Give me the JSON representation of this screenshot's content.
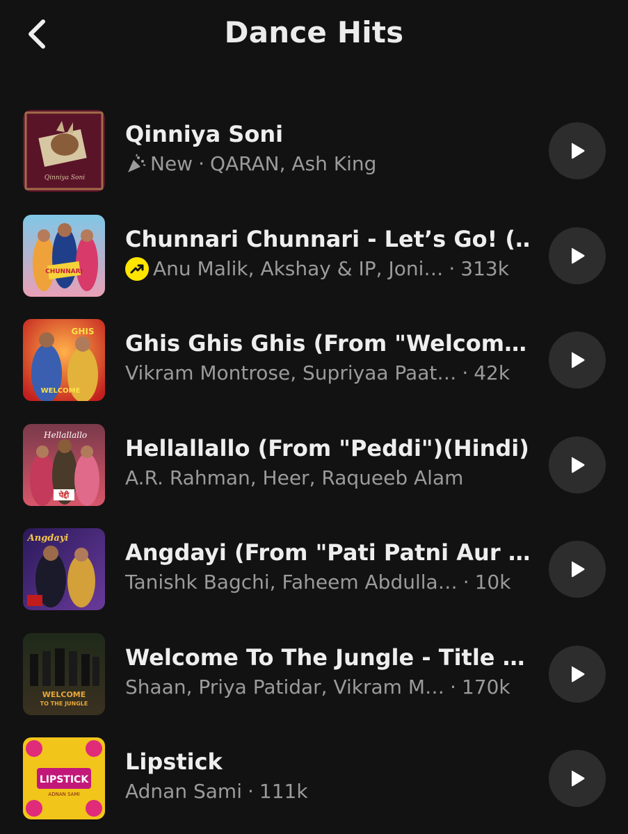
{
  "header": {
    "title": "Dance Hits",
    "back_icon": "chevron-left-icon"
  },
  "colors": {
    "background": "#121212",
    "play_button_bg": "#2d2d2d",
    "trending_badge": "#ffe500",
    "subtitle_text": "#9b9b9b"
  },
  "tracks": [
    {
      "title": "Qinniya Soni",
      "badge_icon": "party-popper-icon",
      "new_label": "New",
      "artists": "QARAN, Ash King",
      "plays": ""
    },
    {
      "title": "Chunnari Chunnari - Let’s Go! (…",
      "badge_icon": "trending-up-icon",
      "artists": "Anu Malik, Akshay & IP, Joni…",
      "plays": "313k"
    },
    {
      "title": "Ghis Ghis Ghis (From \"Welcom…",
      "artists": "Vikram Montrose, Supriyaa Paat…",
      "plays": "42k"
    },
    {
      "title": "Hellallallo (From \"Peddi\")(Hindi)",
      "artists": "A.R. Rahman, Heer, Raqueeb Alam",
      "plays": ""
    },
    {
      "title": "Angdayi (From \"Pati Patni Aur …",
      "artists": "Tanishk Bagchi, Faheem Abdulla…",
      "plays": "10k"
    },
    {
      "title": "Welcome To The Jungle - Title …",
      "artists": "Shaan, Priya Patidar, Vikram M…",
      "plays": "170k"
    },
    {
      "title": "Lipstick",
      "artists": "Adnan Sami",
      "plays": "111k"
    }
  ],
  "icons": {
    "play": "play-icon"
  }
}
